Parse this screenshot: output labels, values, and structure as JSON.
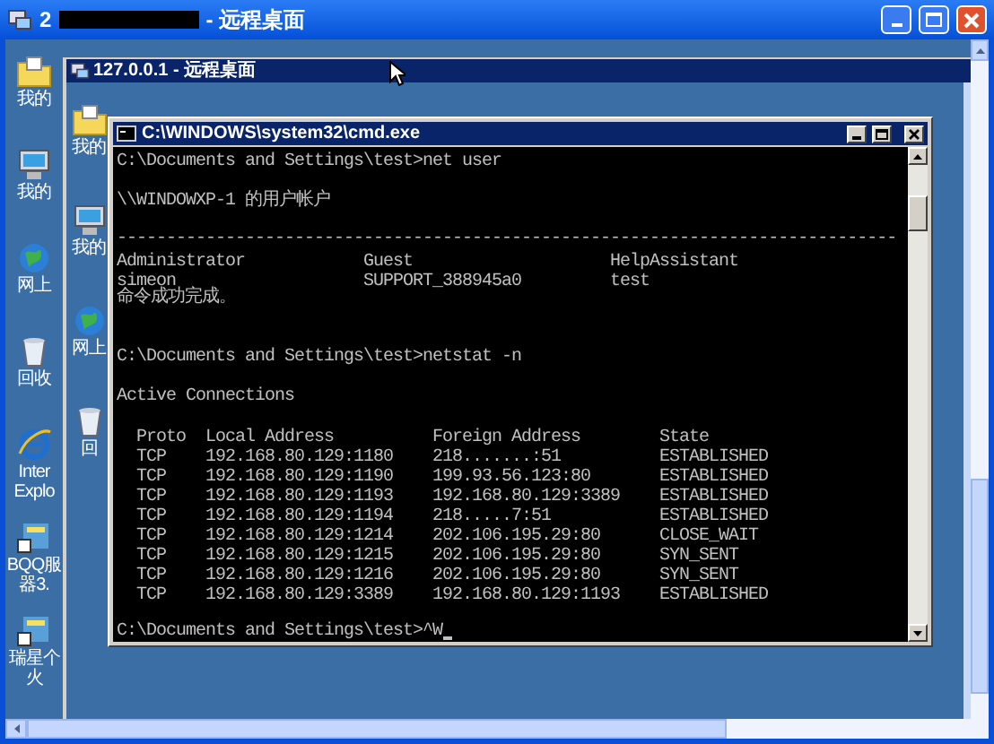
{
  "window": {
    "title_parts": [
      "2",
      "- 远程桌面"
    ]
  },
  "outer_desktop": {
    "icons": [
      {
        "kind": "folder",
        "label_lines": [
          "我的"
        ]
      },
      {
        "kind": "computer",
        "label_lines": [
          "我的"
        ]
      },
      {
        "kind": "network",
        "label_lines": [
          "网上"
        ]
      },
      {
        "kind": "trash",
        "label_lines": [
          "回收"
        ]
      },
      {
        "kind": "browser",
        "label_lines": [
          "Inter",
          "Explo"
        ]
      },
      {
        "kind": "app",
        "label_lines": [
          "BQQ服",
          "器3."
        ]
      },
      {
        "kind": "app",
        "label_lines": [
          "瑞星个",
          "火"
        ]
      }
    ]
  },
  "inner_window": {
    "title": "127.0.0.1 - 远程桌面"
  },
  "inner_desktop": {
    "icons": [
      {
        "kind": "folder",
        "label_lines": [
          "我的"
        ]
      },
      {
        "kind": "computer",
        "label_lines": [
          "我的"
        ]
      },
      {
        "kind": "network",
        "label_lines": [
          "网上"
        ]
      },
      {
        "kind": "trash",
        "label_lines": [
          "回"
        ]
      }
    ]
  },
  "cmd_window": {
    "title": "C:\\WINDOWS\\system32\\cmd.exe",
    "lines": [
      {
        "kind": "text",
        "text": "C:\\Documents and Settings\\test>net user"
      },
      {
        "kind": "blank"
      },
      {
        "kind": "text",
        "text": "\\\\WINDOWXP-1 的用户帐户"
      },
      {
        "kind": "blank"
      },
      {
        "kind": "text",
        "text": "-------------------------------------------------------------------------------"
      },
      {
        "kind": "accounts_row",
        "cells": [
          "Administrator",
          "Guest",
          "HelpAssistant"
        ]
      },
      {
        "kind": "accounts_row",
        "cells": [
          "simeon",
          "SUPPORT_388945a0",
          "test"
        ]
      },
      {
        "kind": "text",
        "text": "命令成功完成。"
      },
      {
        "kind": "blank"
      },
      {
        "kind": "blank"
      },
      {
        "kind": "text",
        "text": "C:\\Documents and Settings\\test>netstat -n"
      },
      {
        "kind": "blank"
      },
      {
        "kind": "text",
        "text": "Active Connections"
      },
      {
        "kind": "blank"
      },
      {
        "kind": "connection_row",
        "cells": [
          "Proto",
          "Local Address",
          "Foreign Address",
          "State"
        ]
      },
      {
        "kind": "connection_row",
        "cells": [
          "TCP",
          "192.168.80.129:1180",
          "218.......:51",
          "ESTABLISHED"
        ]
      },
      {
        "kind": "connection_row",
        "cells": [
          "TCP",
          "192.168.80.129:1190",
          "199.93.56.123:80",
          "ESTABLISHED"
        ]
      },
      {
        "kind": "connection_row",
        "cells": [
          "TCP",
          "192.168.80.129:1193",
          "192.168.80.129:3389",
          "ESTABLISHED"
        ]
      },
      {
        "kind": "connection_row",
        "cells": [
          "TCP",
          "192.168.80.129:1194",
          "218.....7:51",
          "ESTABLISHED"
        ]
      },
      {
        "kind": "connection_row",
        "cells": [
          "TCP",
          "192.168.80.129:1214",
          "202.106.195.29:80",
          "CLOSE_WAIT"
        ]
      },
      {
        "kind": "connection_row",
        "cells": [
          "TCP",
          "192.168.80.129:1215",
          "202.106.195.29:80",
          "SYN_SENT"
        ]
      },
      {
        "kind": "connection_row",
        "cells": [
          "TCP",
          "192.168.80.129:1216",
          "202.106.195.29:80",
          "SYN_SENT"
        ]
      },
      {
        "kind": "connection_row",
        "cells": [
          "TCP",
          "192.168.80.129:3389",
          "192.168.80.129:1193",
          "ESTABLISHED"
        ]
      },
      {
        "kind": "blank"
      },
      {
        "kind": "prompt",
        "text": "C:\\Documents and Settings\\test>^W"
      }
    ]
  }
}
